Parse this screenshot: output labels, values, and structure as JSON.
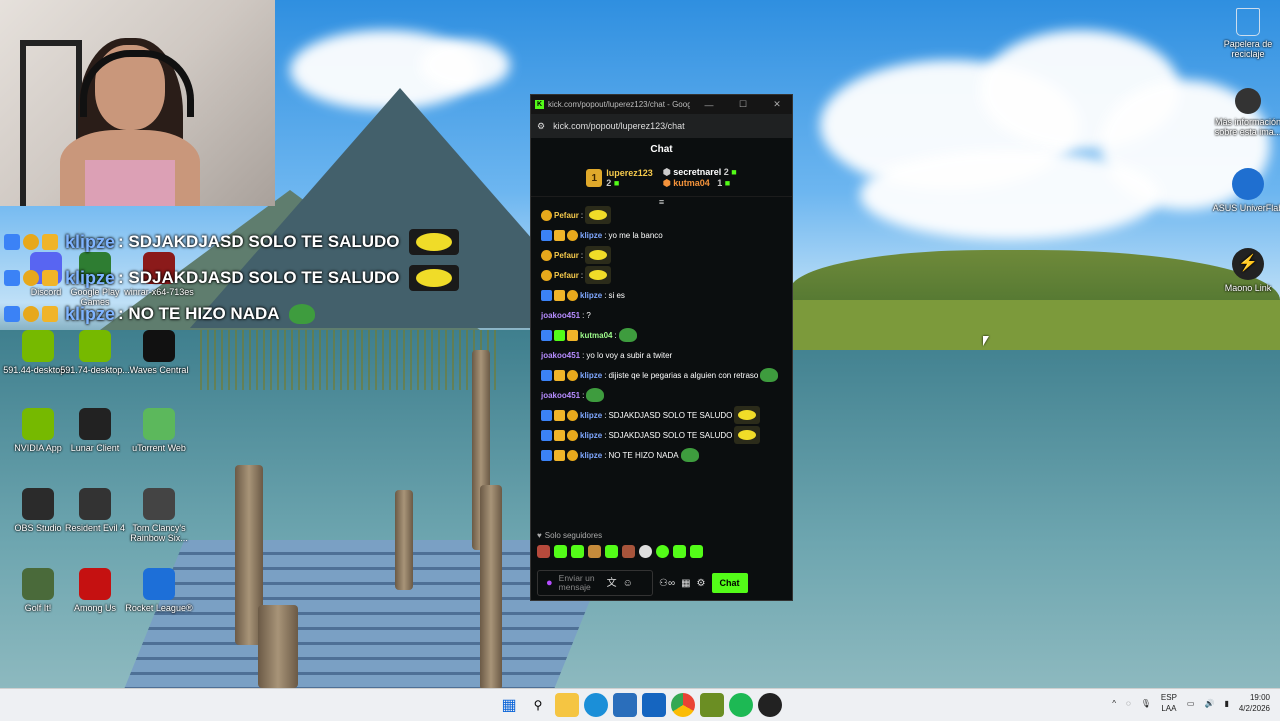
{
  "overlay_chat": [
    {
      "user": "klipze",
      "text": ": SDJAKDJASD SOLO TE SALUDO",
      "emote": "pepe-yellow"
    },
    {
      "user": "klipze",
      "text": ": SDJAKDJASD SOLO TE SALUDO",
      "emote": "pepe-yellow"
    },
    {
      "user": "klipze",
      "text": ": NO TE HIZO NADA",
      "emote": "frog"
    }
  ],
  "desktop_icons": [
    {
      "label": "Discord",
      "icon": "discord-icon",
      "color": "#5865f2"
    },
    {
      "label": "Google Play Games",
      "icon": "google-play-icon",
      "color": "#2e7d32"
    },
    {
      "label": "winrar-x64-713es",
      "icon": "winrar-icon",
      "color": "#8b1a1a"
    },
    {
      "label": "591.44-desktop...",
      "icon": "nvidia-installer-icon",
      "color": "#76b900"
    },
    {
      "label": "591.74-desktop...",
      "icon": "nvidia-installer-icon",
      "color": "#76b900"
    },
    {
      "label": "Waves Central",
      "icon": "waves-icon",
      "color": "#111111"
    },
    {
      "label": "NVIDIA App",
      "icon": "nvidia-icon",
      "color": "#76b900"
    },
    {
      "label": "Lunar Client",
      "icon": "lunar-icon",
      "color": "#222222"
    },
    {
      "label": "uTorrent Web",
      "icon": "utorrent-icon",
      "color": "#5cb85c"
    },
    {
      "label": "OBS Studio",
      "icon": "obs-icon",
      "color": "#2b2b2b"
    },
    {
      "label": "Resident Evil 4",
      "icon": "re4-icon",
      "color": "#333333"
    },
    {
      "label": "Tom Clancy's Rainbow Six...",
      "icon": "r6-icon",
      "color": "#444444"
    },
    {
      "label": "Golf It!",
      "icon": "golfit-icon",
      "color": "#4a6a3a"
    },
    {
      "label": "Among Us",
      "icon": "amongus-icon",
      "color": "#c51111"
    },
    {
      "label": "Rocket League®",
      "icon": "rocketleague-icon",
      "color": "#1d6fd8"
    }
  ],
  "right_icons": [
    {
      "label": "Papelera de reciclaje",
      "icon": "recycle-bin-icon"
    },
    {
      "label": "Más información sobre esta ima...",
      "icon": "info-icon"
    },
    {
      "label": "ASUS UniverFlab",
      "icon": "asus-icon"
    },
    {
      "label": "Maono Link",
      "icon": "maono-icon"
    }
  ],
  "browser": {
    "title": "kick.com/popout/luperez123/chat - Googl...",
    "url": "kick.com/popout/luperez123/chat",
    "chat_header": "Chat",
    "leaderboard": {
      "first": {
        "rank": "1",
        "name": "luperez123",
        "count": "2"
      },
      "second": {
        "name": "secretnarel",
        "count": "2"
      },
      "third": {
        "name": "kutma04",
        "count": "1"
      }
    },
    "messages": [
      {
        "user": "Pefaur",
        "sep": ":",
        "text": "",
        "emote": "pepe",
        "badges": [
          "gold"
        ],
        "ucolor": "gold"
      },
      {
        "user": "klipze",
        "sep": ":",
        "text": "yo me la banco",
        "emote": "",
        "badges": [
          "blue",
          "crown",
          "gold"
        ],
        "ucolor": "blue"
      },
      {
        "user": "Pefaur",
        "sep": ":",
        "text": "",
        "emote": "pepe",
        "badges": [
          "gold"
        ],
        "ucolor": "gold"
      },
      {
        "user": "Pefaur",
        "sep": ":",
        "text": "",
        "emote": "pepe",
        "badges": [
          "gold"
        ],
        "ucolor": "gold"
      },
      {
        "user": "klipze",
        "sep": ":",
        "text": "si es",
        "emote": "",
        "badges": [
          "blue",
          "crown",
          "gold"
        ],
        "ucolor": "blue"
      },
      {
        "user": "joakoo451",
        "sep": ":",
        "text": "?",
        "emote": "",
        "badges": [],
        "ucolor": "purple"
      },
      {
        "user": "kutma04",
        "sep": ":",
        "text": "",
        "emote": "frog",
        "badges": [
          "blue",
          "green",
          "crown"
        ],
        "ucolor": "green"
      },
      {
        "user": "joakoo451",
        "sep": ":",
        "text": "yo lo voy a subir a twiter",
        "emote": "",
        "badges": [],
        "ucolor": "purple"
      },
      {
        "user": "klipze",
        "sep": ":",
        "text": "dijiste qe le pegarias a alguien con retraso",
        "emote": "frog",
        "badges": [
          "blue",
          "crown",
          "gold"
        ],
        "ucolor": "blue"
      },
      {
        "user": "joakoo451",
        "sep": ":",
        "text": "",
        "emote": "frog",
        "badges": [],
        "ucolor": "purple"
      },
      {
        "user": "klipze",
        "sep": ":",
        "text": "SDJAKDJASD SOLO TE SALUDO",
        "emote": "pepe",
        "badges": [
          "blue",
          "crown",
          "gold"
        ],
        "ucolor": "blue"
      },
      {
        "user": "klipze",
        "sep": ":",
        "text": "SDJAKDJASD SOLO TE SALUDO",
        "emote": "pepe",
        "badges": [
          "blue",
          "crown",
          "gold"
        ],
        "ucolor": "blue"
      },
      {
        "user": "klipze",
        "sep": ":",
        "text": "NO TE HIZO NADA",
        "emote": "frog",
        "badges": [
          "blue",
          "crown",
          "gold"
        ],
        "ucolor": "blue"
      }
    ],
    "followers_only": "Solo seguidores",
    "input_placeholder": "Enviar un mensaje",
    "send_button": "Chat"
  },
  "taskbar": {
    "lang": "ESP",
    "region": "LAA",
    "time": "19:00",
    "date": "4/2/2026"
  },
  "colors": {
    "kick_green": "#53fc18",
    "accent_blue": "#3b82f6"
  }
}
